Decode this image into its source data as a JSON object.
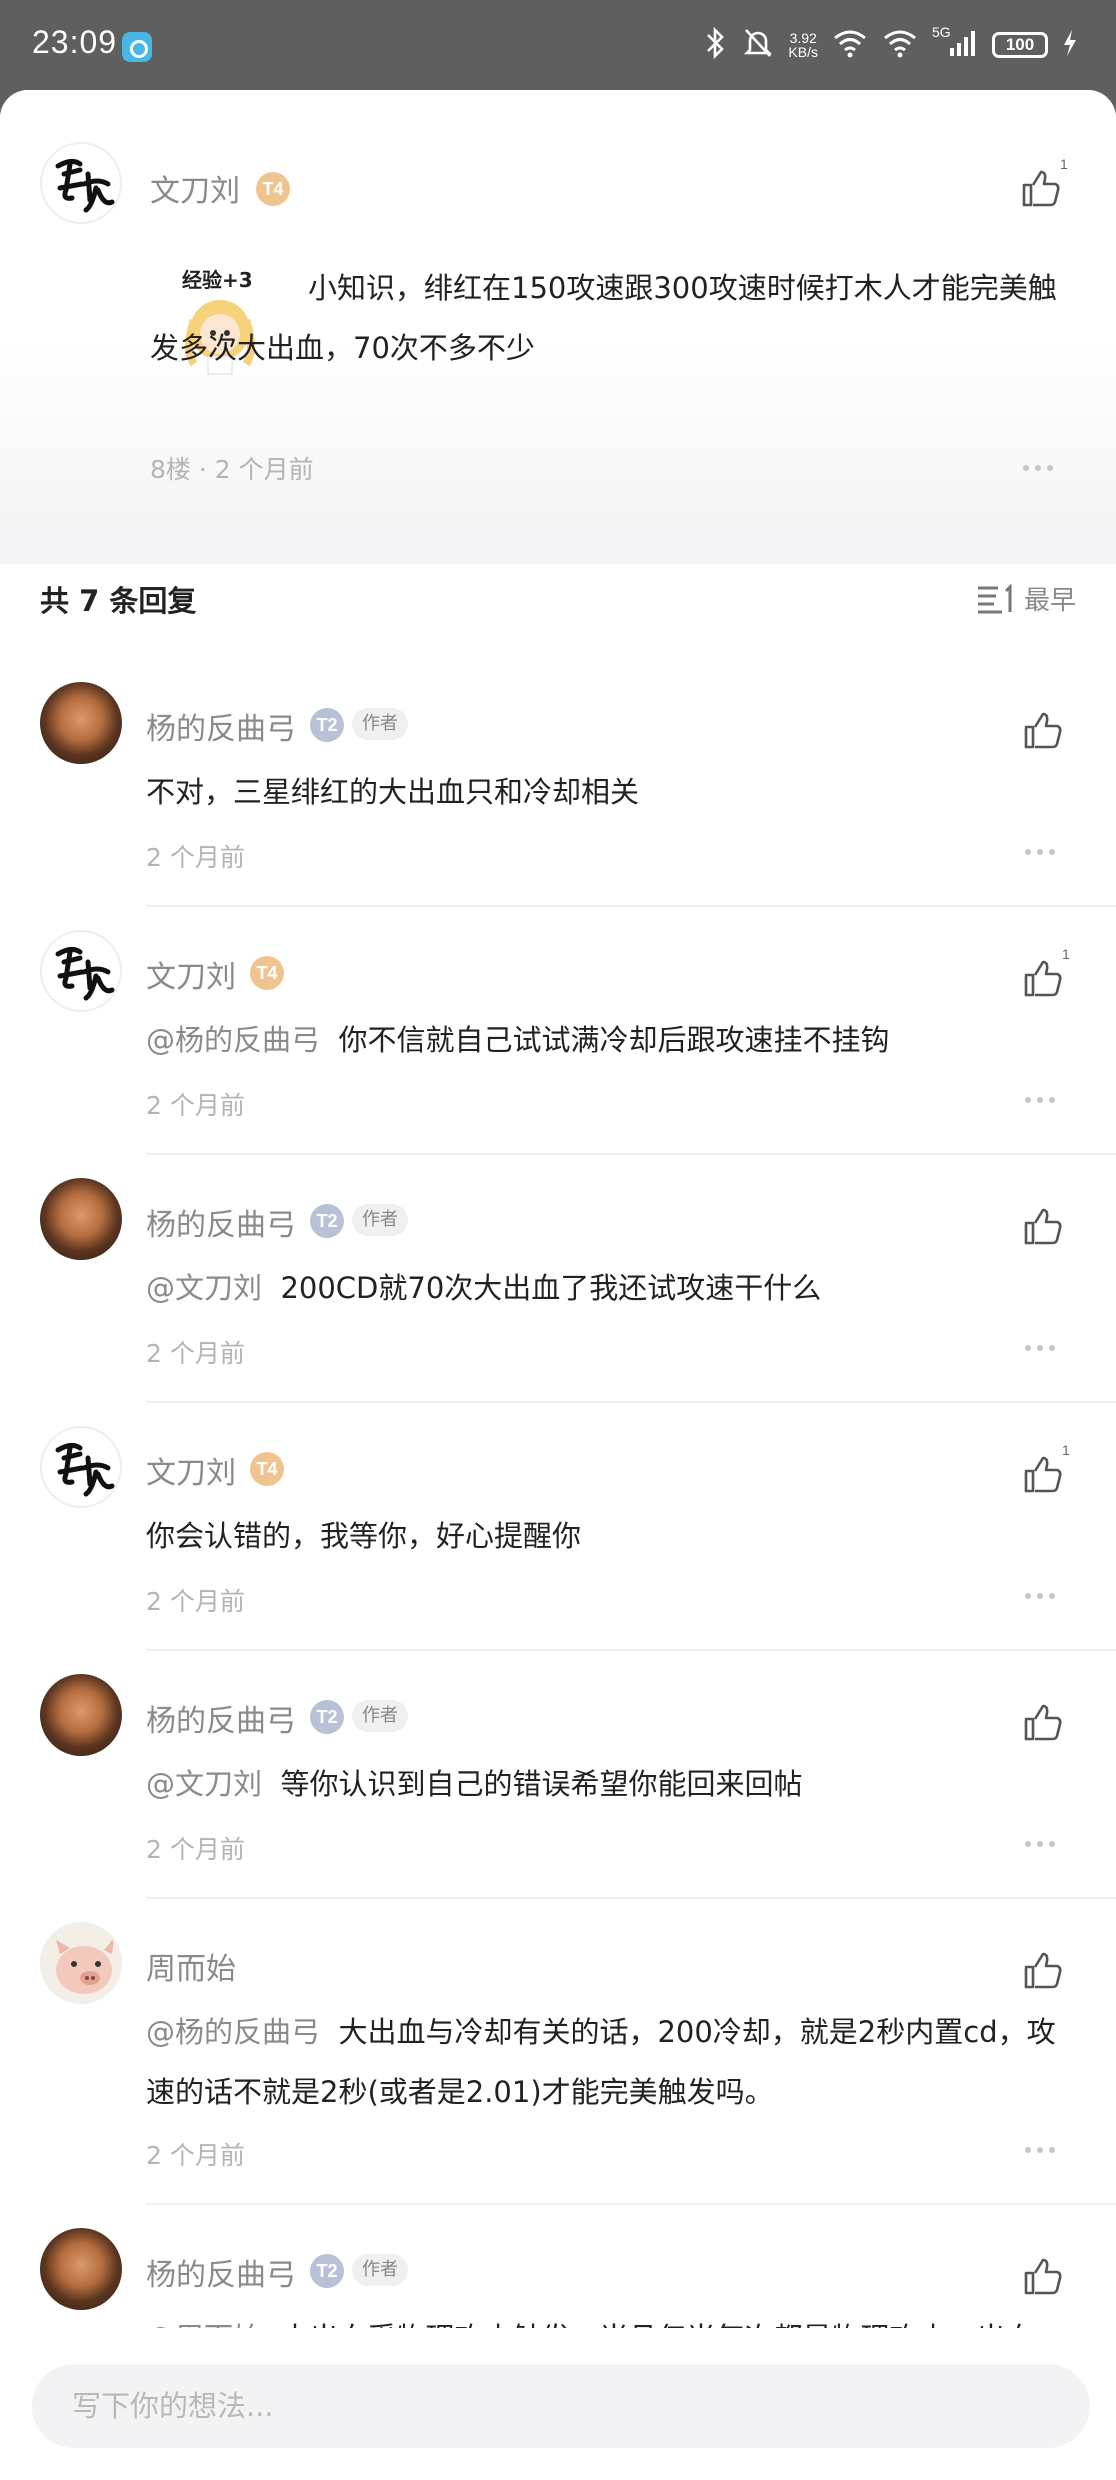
{
  "status_bar": {
    "time": "23:09",
    "net_speed_value": "3.92",
    "net_speed_unit": "KB/s",
    "network": "5G",
    "battery": "100"
  },
  "post": {
    "author": "文刀刘",
    "level": "T4",
    "text": "小知识，绯红在150攻速跟300攻速时候打木人才能完美触发多次大出血，70次不多不少",
    "meta": "8楼 · 2 个月前",
    "likes": "1",
    "sticker_text": "经验+3"
  },
  "replies_header": {
    "title": "共 7 条回复",
    "sort_label": "最早"
  },
  "replies": [
    {
      "author": "杨的反曲弓",
      "level": "T2",
      "tag": "作者",
      "mention": "",
      "text": "不对，三星绯红的大出血只和冷却相关",
      "time": "2 个月前",
      "likes": ""
    },
    {
      "author": "文刀刘",
      "level": "T4",
      "tag": "",
      "mention": "@杨的反曲弓",
      "text": "你不信就自己试试满冷却后跟攻速挂不挂钩",
      "time": "2 个月前",
      "likes": "1"
    },
    {
      "author": "杨的反曲弓",
      "level": "T2",
      "tag": "作者",
      "mention": "@文刀刘",
      "text": "200CD就70次大出血了我还试攻速干什么",
      "time": "2 个月前",
      "likes": ""
    },
    {
      "author": "文刀刘",
      "level": "T4",
      "tag": "",
      "mention": "",
      "text": "你会认错的，我等你，好心提醒你",
      "time": "2 个月前",
      "likes": "1"
    },
    {
      "author": "杨的反曲弓",
      "level": "T2",
      "tag": "作者",
      "mention": "@文刀刘",
      "text": "等你认识到自己的错误希望你能回来回帖",
      "time": "2 个月前",
      "likes": ""
    },
    {
      "author": "周而始",
      "level": "",
      "tag": "",
      "mention": "@杨的反曲弓",
      "text": "大出血与冷却有关的话，200冷却，就是2秒内置cd，攻速的话不就是2秒(或者是2.01)才能完美触发吗。",
      "time": "2 个月前",
      "likes": ""
    },
    {
      "author": "杨的反曲弓",
      "level": "T2",
      "tag": "作者",
      "mention": "@周而始",
      "text": "大出血受物理攻击触发，当且仅当每次都是物理攻击，出血",
      "time": "",
      "likes": ""
    }
  ],
  "composer": {
    "placeholder": "写下你的想法..."
  },
  "colors": {
    "accent_gold": "#f0c48f",
    "accent_blue": "#b9c1d8",
    "muted_text": "#8a8a8a"
  }
}
